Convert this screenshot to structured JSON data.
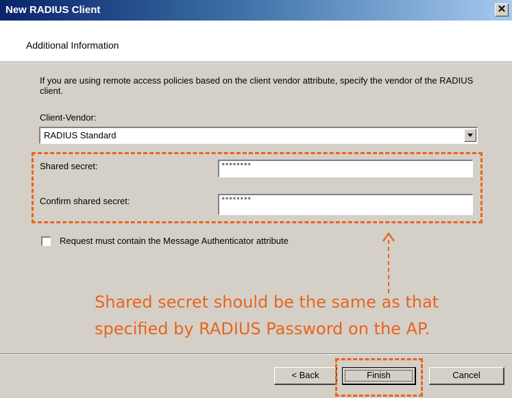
{
  "window": {
    "title": "New RADIUS Client",
    "close_glyph": "✕"
  },
  "header": {
    "title": "Additional Information"
  },
  "description": "If you are using remote access policies based on the client vendor attribute, specify the vendor of the RADIUS client.",
  "vendor": {
    "label": "Client-Vendor:",
    "selected": "RADIUS Standard"
  },
  "shared_secret": {
    "label": "Shared secret:",
    "value": "********"
  },
  "confirm_secret": {
    "label": "Confirm shared secret:",
    "value": "********"
  },
  "checkbox": {
    "label": "Request must contain the Message Authenticator attribute",
    "checked": false
  },
  "annotation": {
    "line1": "Shared secret should be the same as that",
    "line2": "specified by RADIUS Password on the AP.",
    "color": "#e8641e"
  },
  "buttons": {
    "back": "< Back",
    "finish": "Finish",
    "cancel": "Cancel"
  }
}
